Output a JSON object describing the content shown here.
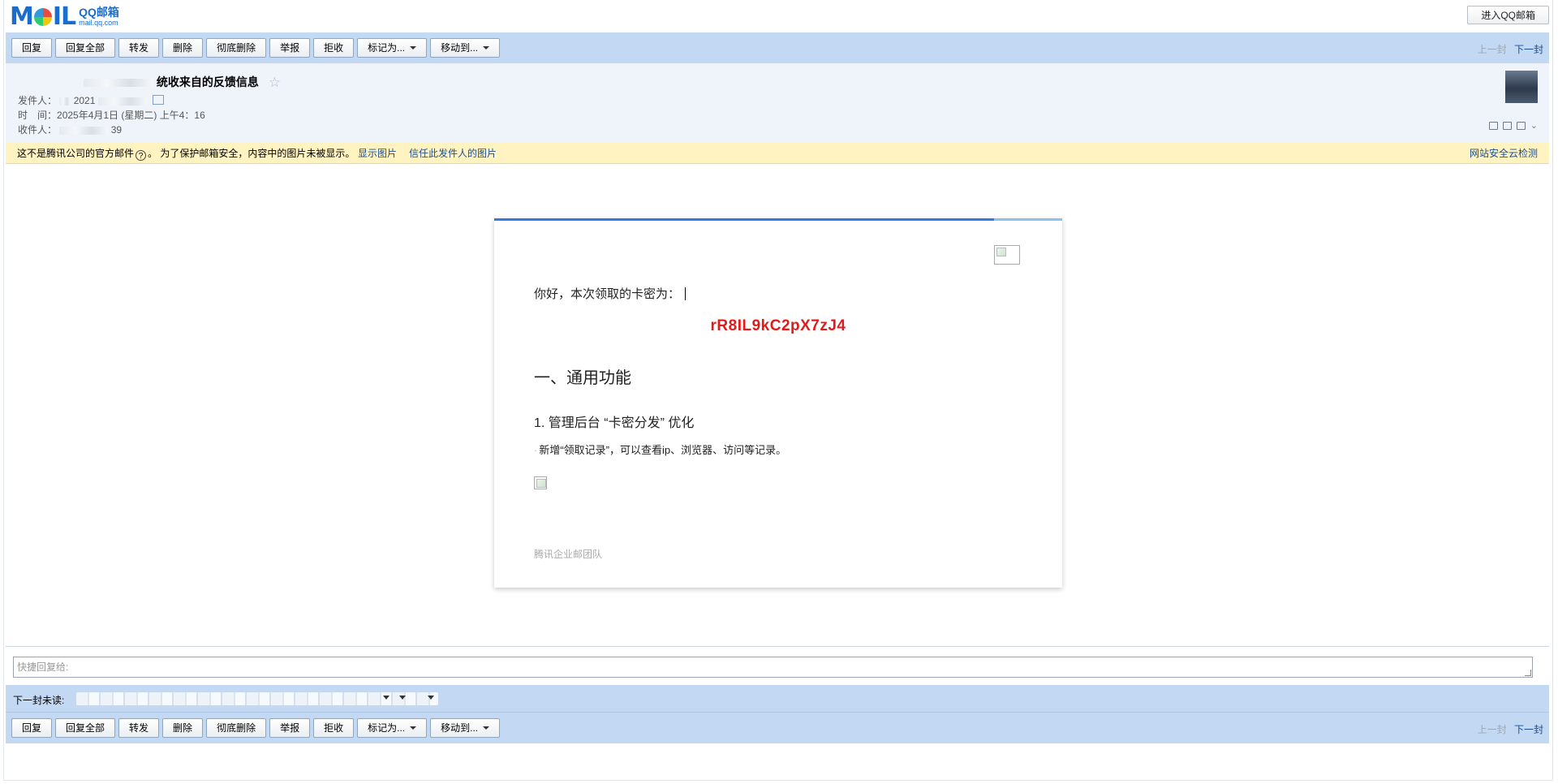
{
  "app": {
    "logo_text": "MOIL",
    "logo_name": "QQ邮箱",
    "logo_domain": "mail.qq.com",
    "enter_button": "进入QQ邮箱"
  },
  "toolbar": {
    "reply": "回复",
    "reply_all": "回复全部",
    "forward": "转发",
    "delete": "删除",
    "delete_permanently": "彻底删除",
    "report": "举报",
    "reject": "拒收",
    "mark_as": "标记为...",
    "move_to": "移动到...",
    "prev": "上一封",
    "next": "下一封"
  },
  "header": {
    "subject": "统收来自的反馈信息",
    "sender_label": "发件人：",
    "sender_value": "2021",
    "time_label": "时　间：",
    "time_value": "2025年4月1日 (星期二) 上午4：16",
    "recipient_label": "收件人：",
    "recipient_value": "39"
  },
  "warning": {
    "text": "这不是腾讯公司的官方邮件",
    "help": "?",
    "text2": "。 为了保护邮箱安全，内容中的图片未被显示。",
    "show_images": "显示图片",
    "trust_sender": "信任此发件人的图片",
    "cloud_check": "网站安全云检测"
  },
  "email_body": {
    "greeting": "你好，本次领取的卡密为：",
    "card_code": "rR8IL9kC2pX7zJ4",
    "heading1": "一、通用功能",
    "heading2": "1. 管理后台 “卡密分发” 优化",
    "bullet": "新增“领取记录”，可以查看ip、浏览器、访问等记录。",
    "signature": "腾讯企业邮团队"
  },
  "reply": {
    "placeholder": "快捷回复给:"
  },
  "next_unread": {
    "label": "下一封未读:"
  },
  "colors": {
    "toolbar_bg": "#c3d9f3",
    "header_bg": "#eff4fb",
    "warning_bg": "#fff4c1",
    "link": "#1a4f91",
    "card_code": "#e01b1b",
    "accent_bar": "#2f7de1"
  }
}
